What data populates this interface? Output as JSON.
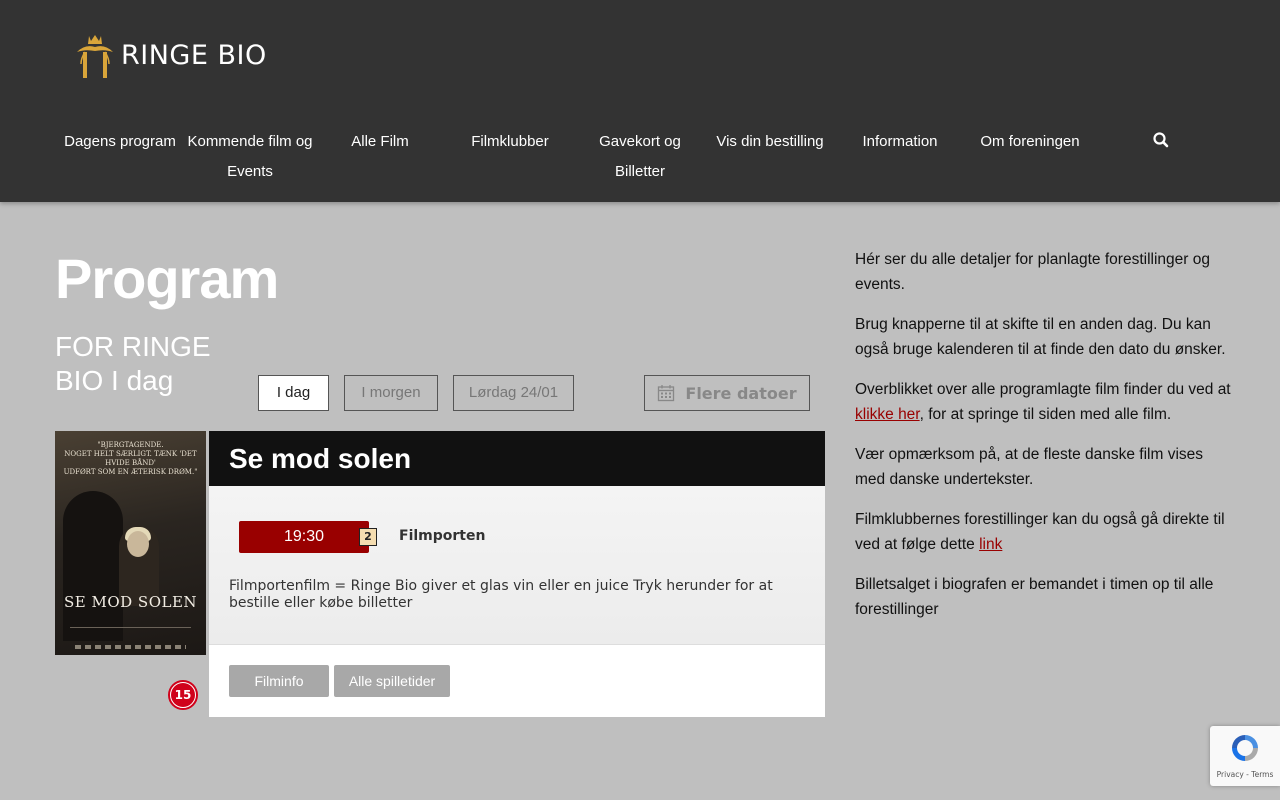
{
  "brand": {
    "name": "RINGE BIO",
    "logo_icon": "crown-pillars-logo"
  },
  "nav": {
    "items": [
      {
        "label": "Dagens program"
      },
      {
        "label": "Kommende film og Events"
      },
      {
        "label": "Alle Film"
      },
      {
        "label": "Filmklubber"
      },
      {
        "label": "Gavekort og Billetter"
      },
      {
        "label": "Vis din bestilling"
      },
      {
        "label": "Information"
      },
      {
        "label": "Om foreningen"
      }
    ],
    "search_icon": "search-icon"
  },
  "page": {
    "title": "Program",
    "subtitle": "FOR RINGE BIO I dag"
  },
  "day_buttons": [
    {
      "label": "I dag",
      "active": true
    },
    {
      "label": "I morgen",
      "active": false
    },
    {
      "label": "Lørdag 24/01",
      "active": false
    }
  ],
  "more_dates": {
    "label": "Flere datoer",
    "icon": "calendar-icon"
  },
  "movie": {
    "title": "Se mod solen",
    "poster": {
      "quote": "\"BJERGTAGENDE.\nNOGET HELT SÆRLIGT. TÆNK 'DET HVIDE BÅND'\nUDFØRT SOM EN ÆTERISK DRØM.\"",
      "title": "SE MOD SOLEN"
    },
    "rating": "15",
    "showtime": {
      "time": "19:30",
      "hall": "2",
      "venue": "Filmporten"
    },
    "description": "Filmportenfilm = Ringe Bio giver et glas vin eller en juice Tryk herunder for at bestille eller købe billetter",
    "buttons": {
      "info": "Filminfo",
      "all_times": "Alle spilletider"
    }
  },
  "sidebar": {
    "p1": "Hér ser du alle detaljer for planlagte forestillinger og events.",
    "p2": "Brug knapperne til at skifte til en anden dag. Du kan også bruge kalenderen til at finde den dato du ønsker.",
    "p3_before": "Overblikket over alle programlagte film finder du ved at ",
    "p3_link": "klikke her",
    "p3_after": ", for at springe til siden med alle film.",
    "p4": "Vær opmærksom på, at de fleste danske film vises med danske undertekster.",
    "p5_before": "Filmklubbernes forestillinger kan du også gå direkte til ved at følge dette ",
    "p5_link": "link",
    "p6": "Billetsalget i biografen er bemandet i timen op til alle forestillinger"
  },
  "recaptcha": {
    "text": "Privacy - Terms"
  },
  "colors": {
    "header_bg": "#333333",
    "page_bg": "#bfbfbf",
    "accent": "#990000",
    "rating": "#d0021b"
  }
}
